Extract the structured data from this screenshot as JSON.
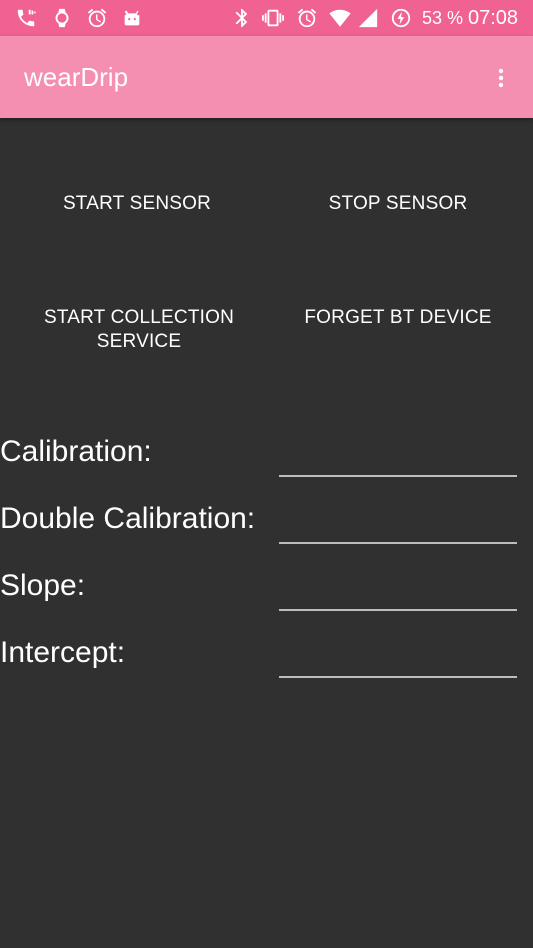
{
  "status_bar": {
    "battery_percent": "53 %",
    "time": "07:08",
    "left_icons": [
      "phone-vibrate-icon",
      "watch-icon",
      "alarm-icon",
      "android-icon"
    ],
    "right_icons": [
      "bluetooth-icon",
      "vibrate-icon",
      "alarm-icon",
      "wifi-icon",
      "signal-icon",
      "battery-charging-icon"
    ],
    "color": "#f06292"
  },
  "app_bar": {
    "title": "wearDrip",
    "menu_icon": "more-vert-icon",
    "color": "#f48fb1"
  },
  "buttons": {
    "start_sensor": "START SENSOR",
    "stop_sensor": "STOP SENSOR",
    "start_collection": "START COLLECTION SERVICE",
    "forget_bt": "FORGET BT DEVICE"
  },
  "fields": [
    {
      "label": "Calibration:",
      "value": ""
    },
    {
      "label": "Double Calibration:",
      "value": ""
    },
    {
      "label": "Slope:",
      "value": ""
    },
    {
      "label": "Intercept:",
      "value": ""
    }
  ],
  "background_color": "#303030"
}
